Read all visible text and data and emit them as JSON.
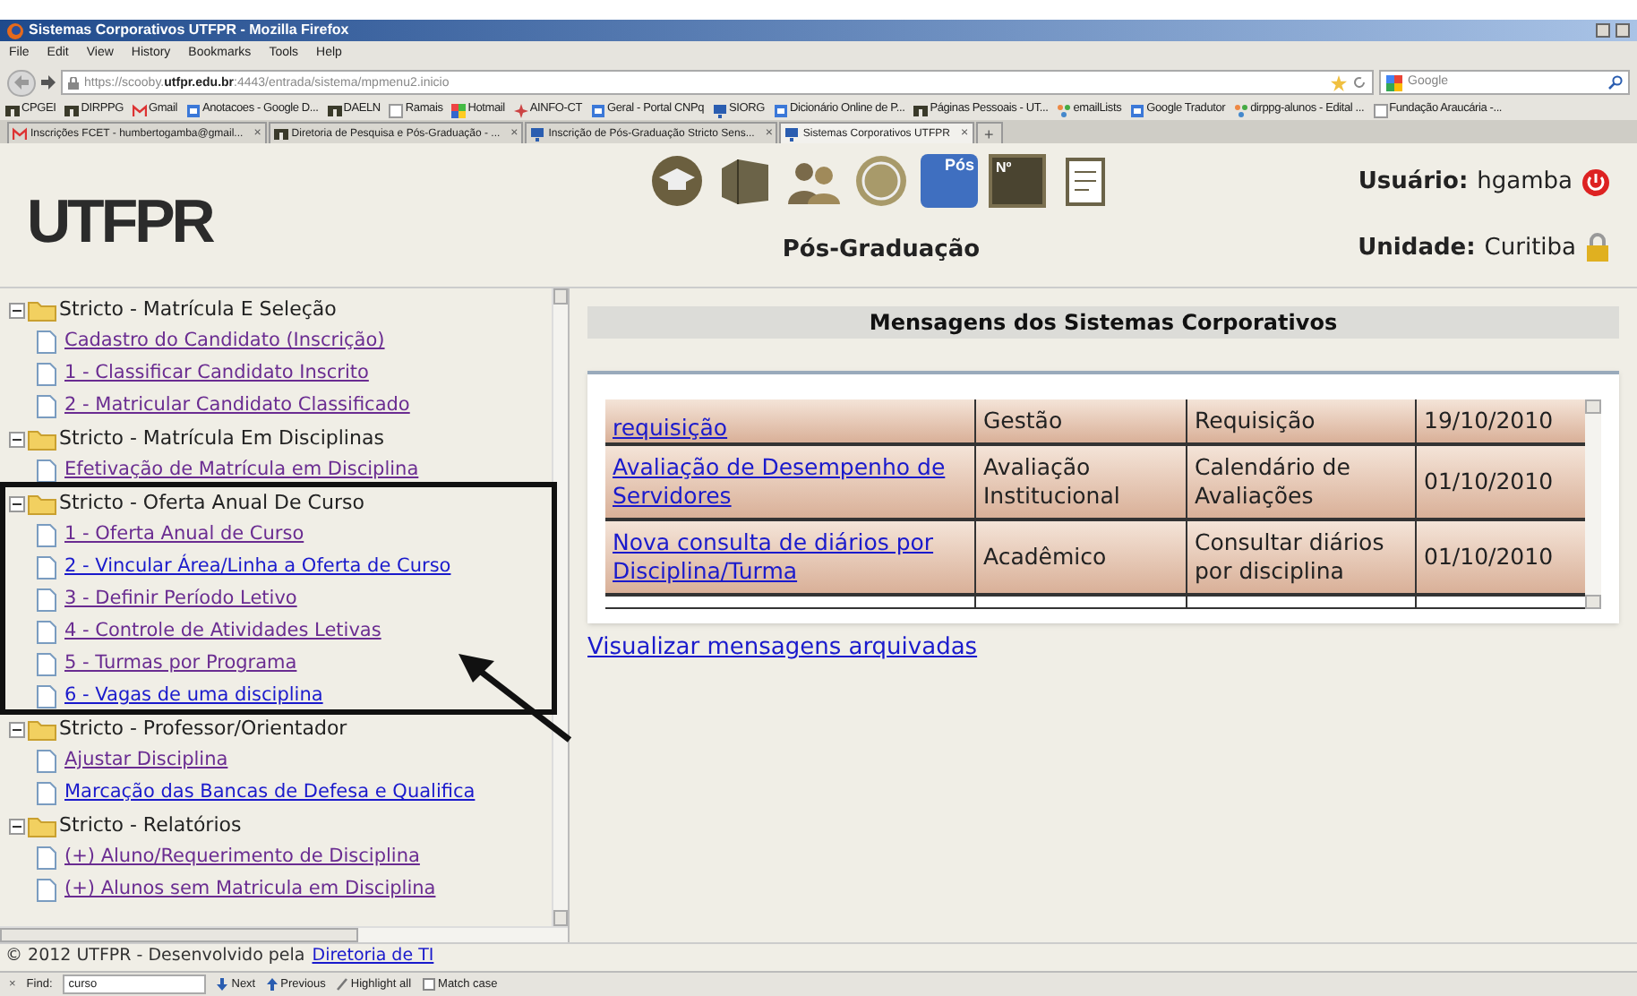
{
  "window": {
    "title": "Sistemas Corporativos UTFPR - Mozilla Firefox"
  },
  "menu": [
    "File",
    "Edit",
    "View",
    "History",
    "Bookmarks",
    "Tools",
    "Help"
  ],
  "address": {
    "value": "https://scooby.**utfpr.edu.br**:4443/entrada/sistema/mpmenu2.inicio"
  },
  "search": {
    "placeholder": "Google"
  },
  "bookmarks": [
    {
      "label": "CPGEI",
      "kind": "utf"
    },
    {
      "label": "DIRPPG",
      "kind": "utf"
    },
    {
      "label": "Gmail",
      "kind": "mail"
    },
    {
      "label": "Anotacoes - Google D...",
      "kind": "doc"
    },
    {
      "label": "DAELN",
      "kind": "utf"
    },
    {
      "label": "Ramais",
      "kind": "page"
    },
    {
      "label": "Hotmail",
      "kind": "flag"
    },
    {
      "label": "AINFO-CT",
      "kind": "star"
    },
    {
      "label": "Geral - Portal CNPq",
      "kind": "doc"
    },
    {
      "label": "SIORG",
      "kind": "monitor"
    },
    {
      "label": "Dicionário Online de P...",
      "kind": "doc"
    },
    {
      "label": "Páginas Pessoais - UT...",
      "kind": "utf"
    },
    {
      "label": "emailLists",
      "kind": "dots"
    },
    {
      "label": "Google Tradutor",
      "kind": "doc"
    },
    {
      "label": "dirppg-alunos - Edital ...",
      "kind": "dots"
    },
    {
      "label": "Fundação Araucária -...",
      "kind": "page"
    }
  ],
  "tabs": [
    {
      "label": "Inscrições FCET - humbertogamba@gmail...",
      "kind": "mail",
      "close": "×",
      "selected": false
    },
    {
      "label": "Diretoria de Pesquisa e Pós-Graduação - ...",
      "kind": "utf",
      "close": "×",
      "selected": false
    },
    {
      "label": "Inscrição de Pós-Graduação Stricto Sens...",
      "kind": "monitor",
      "close": "×",
      "selected": false
    },
    {
      "label": "Sistemas Corporativos UTFPR",
      "kind": "monitor",
      "close": "×",
      "selected": true
    }
  ],
  "new_tab": "+",
  "header": {
    "logo": "UTFPR",
    "section": "Pós-Graduação",
    "modules": [
      {
        "kind": "cap"
      },
      {
        "kind": "box"
      },
      {
        "kind": "people"
      },
      {
        "kind": "coin"
      },
      {
        "kind": "globe",
        "label": "Pós"
      },
      {
        "kind": "card",
        "label": "Nº"
      },
      {
        "kind": "note"
      }
    ],
    "user_label": "Usuário:",
    "user": "hgamba",
    "unit_label": "Unidade:",
    "unit": "Curitiba"
  },
  "tree": [
    {
      "label": "Stricto - Matrícula E Seleção",
      "expanded": true,
      "children": [
        {
          "label": "Cadastro do Candidato (Inscrição)",
          "visited": true
        },
        {
          "label": "1 - Classificar Candidato Inscrito",
          "visited": true
        },
        {
          "label": "2 - Matricular Candidato Classificado",
          "visited": true
        }
      ]
    },
    {
      "label": "Stricto - Matrícula Em Disciplinas",
      "expanded": true,
      "children": [
        {
          "label": "Efetivação de Matrícula em Disciplina",
          "visited": true
        }
      ]
    },
    {
      "label": "Stricto - Oferta Anual De Curso",
      "expanded": true,
      "children": [
        {
          "label": "1 - Oferta Anual de Curso",
          "visited": true
        },
        {
          "label": "2 - Vincular Área/Linha a Oferta de Curso",
          "visited": false
        },
        {
          "label": "3 - Definir Período Letivo",
          "visited": true
        },
        {
          "label": "4 - Controle de Atividades Letivas",
          "visited": true
        },
        {
          "label": "5 - Turmas por Programa",
          "visited": true
        },
        {
          "label": "6 - Vagas de uma disciplina",
          "visited": false
        }
      ]
    },
    {
      "label": "Stricto - Professor/Orientador",
      "expanded": true,
      "children": [
        {
          "label": "Ajustar Disciplina",
          "visited": true
        },
        {
          "label": "Marcação das Bancas de Defesa e Qualifica",
          "visited": false
        }
      ]
    },
    {
      "label": "Stricto - Relatórios",
      "expanded": true,
      "children": [
        {
          "label": "(+) Aluno/Requerimento de Disciplina",
          "visited": true
        },
        {
          "label": "(+) Alunos sem Matricula em Disciplina",
          "visited": true
        }
      ]
    }
  ],
  "messages": {
    "title": "Mensagens dos Sistemas Corporativos",
    "rows": [
      [
        "requisição",
        "Gestão",
        "Requisição",
        "19/10/2010"
      ],
      [
        "Avaliação de Desempenho de Servidores",
        "Avaliação Institucional",
        "Calendário de Avaliações",
        "01/10/2010"
      ],
      [
        "Nova consulta de diários por Disciplina/Turma",
        "Acadêmico",
        "Consultar diários por disciplina",
        "01/10/2010"
      ]
    ],
    "archive_link": "Visualizar mensagens arquivadas"
  },
  "footer": {
    "text": "© 2012 UTFPR - Desenvolvido pela",
    "link": "Diretoria de TI"
  },
  "find_bar": {
    "close": "×",
    "label": "Find:",
    "value": "curso",
    "next": "Next",
    "previous": "Previous",
    "highlight": "Highlight all",
    "match_case": {
      "label": "Match case",
      "checked": false
    }
  }
}
